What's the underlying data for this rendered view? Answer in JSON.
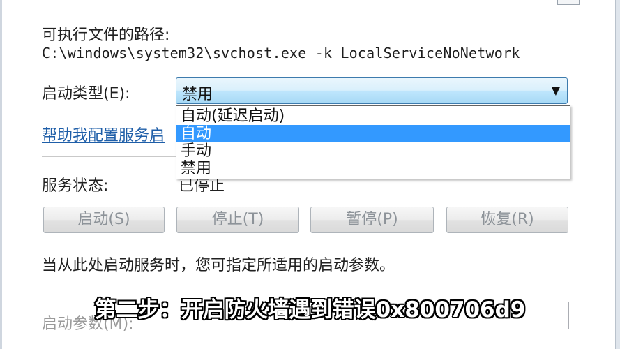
{
  "details": {
    "exe_path_label": "可执行文件的路径:",
    "exe_path_value": "C:\\windows\\system32\\svchost.exe -k LocalServiceNoNetwork",
    "startup_type_label": "启动类型(E):",
    "startup_type_value": "禁用",
    "help_link": "帮助我配置服务启",
    "service_status_label": "服务状态:",
    "service_status_value": "已停止",
    "description": "当从此处启动服务时，您可指定所适用的启动参数。",
    "start_params_label": "启动参数(M):"
  },
  "dropdown": {
    "options": [
      "自动(延迟启动)",
      "自动",
      "手动",
      "禁用"
    ],
    "highlighted_index": 1
  },
  "buttons": {
    "start": "启动(S)",
    "stop": "停止(T)",
    "pause": "暂停(P)",
    "resume": "恢复(R)"
  },
  "caption": "第二步：开启防火墙遇到错误0x800706d9",
  "icons": {
    "dropdown_arrow": "chevron-down-icon"
  }
}
